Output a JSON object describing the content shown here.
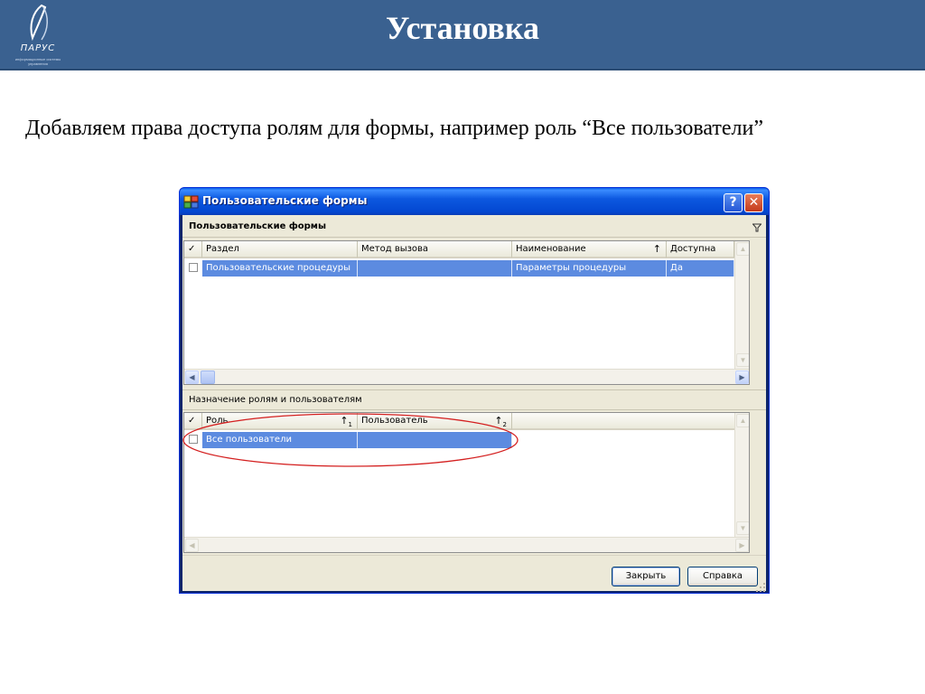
{
  "slide": {
    "logo_text": "ПАРУС",
    "logo_subtext": "информационные системы управления",
    "title": "Установка",
    "subtitle": "Добавляем права доступа ролям для формы, например роль “Все пользователи”"
  },
  "window": {
    "title": "Пользовательские формы",
    "help_glyph": "?",
    "close_glyph": "✕"
  },
  "forms_panel": {
    "header": "Пользовательские формы",
    "columns": {
      "check": "✓",
      "razdel": "Раздел",
      "metod": "Метод вызова",
      "name": "Наименование",
      "name_sort": "↑",
      "dostupna": "Доступна"
    },
    "rows": [
      {
        "razdel": "Пользовательские процедуры",
        "metod": "",
        "name": "Параметры процедуры",
        "dostupna": "Да"
      }
    ]
  },
  "roles_panel": {
    "header": "Назначение ролям и пользователям",
    "columns": {
      "check": "✓",
      "role": "Роль",
      "role_sort": "↑",
      "role_sort_index": "1",
      "user": "Пользователь",
      "user_sort": "↑",
      "user_sort_index": "2"
    },
    "rows": [
      {
        "role": "Все пользователи",
        "user": ""
      }
    ]
  },
  "buttons": {
    "close": "Закрыть",
    "help": "Справка"
  },
  "icons": {
    "scroll_up": "▲",
    "scroll_down": "▼",
    "scroll_left": "◀",
    "scroll_right": "▶"
  },
  "colors": {
    "header_bar": "#3a6190",
    "xp_title_blue": "#0347d1",
    "selection": "#5c8be0",
    "annotation_red": "#d42020"
  }
}
